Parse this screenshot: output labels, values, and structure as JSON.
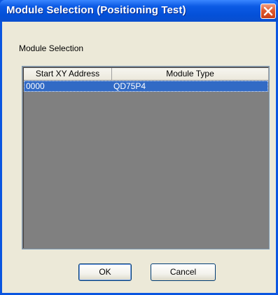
{
  "window": {
    "title": "Module Selection (Positioning Test)"
  },
  "section": {
    "label": "Module Selection"
  },
  "table": {
    "columns": [
      "Start XY Address",
      "Module Type"
    ],
    "rows": [
      {
        "start_xy_address": "0000",
        "module_type": "QD75P4",
        "selected": true
      }
    ]
  },
  "buttons": {
    "ok": "OK",
    "cancel": "Cancel"
  },
  "colors": {
    "title_bar": "#0b5ae4",
    "selection": "#316ac5",
    "list_background": "#808080",
    "dialog_face": "#ece9d8"
  }
}
